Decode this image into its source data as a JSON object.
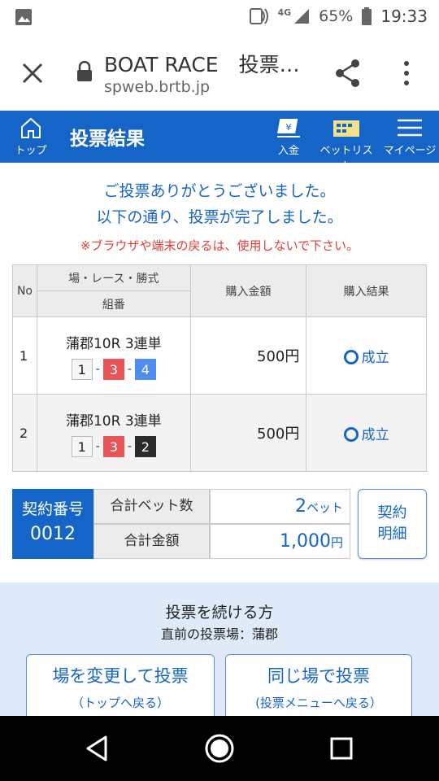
{
  "status_bar": {
    "network": "4G",
    "battery": "65%",
    "time": "19:33"
  },
  "browser": {
    "title": "BOAT RACE　投票…",
    "url": "spweb.brtb.jp"
  },
  "header": {
    "home_label": "トップ",
    "title": "投票結果",
    "deposit_label": "入金",
    "betlist_label": "ベットリスト",
    "mypage_label": "マイページ"
  },
  "messages": {
    "line1": "ご投票ありがとうございました。",
    "line2": "以下の通り、投票が完了しました。",
    "warning": "※ブラウザや端末の戻るは、使用しないで下さい。"
  },
  "table": {
    "headers": {
      "no": "No",
      "race": "場・レース・勝式",
      "combo": "組番",
      "amount": "購入金額",
      "result": "購入結果"
    },
    "rows": [
      {
        "no": "1",
        "race": "蒲郡10R 3連単",
        "combo": [
          "1",
          "3",
          "4"
        ],
        "amount": "500円",
        "result": "成立"
      },
      {
        "no": "2",
        "race": "蒲郡10R 3連単",
        "combo": [
          "1",
          "3",
          "2"
        ],
        "amount": "500円",
        "result": "成立"
      }
    ]
  },
  "summary": {
    "contract_label": "契約番号",
    "contract_number": "0012",
    "total_bets_label": "合計ベット数",
    "total_bets_value": "2",
    "total_bets_unit": "ベット",
    "total_amount_label": "合計金額",
    "total_amount_value": "1,000",
    "total_amount_unit": "円",
    "detail_button_line1": "契約",
    "detail_button_line2": "明細"
  },
  "continue_section": {
    "title": "投票を続ける方",
    "subtitle": "直前の投票場：蒲郡",
    "btn_change_line1": "場を変更して投票",
    "btn_change_line2": "（トップへ戻る）",
    "btn_same_line1": "同じ場で投票",
    "btn_same_line2": "(投票メニューへ戻る）"
  },
  "colors": {
    "brand_blue": "#1565c8",
    "warning_red": "#e53935",
    "box_red": "#e95459",
    "box_blue": "#4f8ef0",
    "box_black": "#2b2b2b"
  }
}
